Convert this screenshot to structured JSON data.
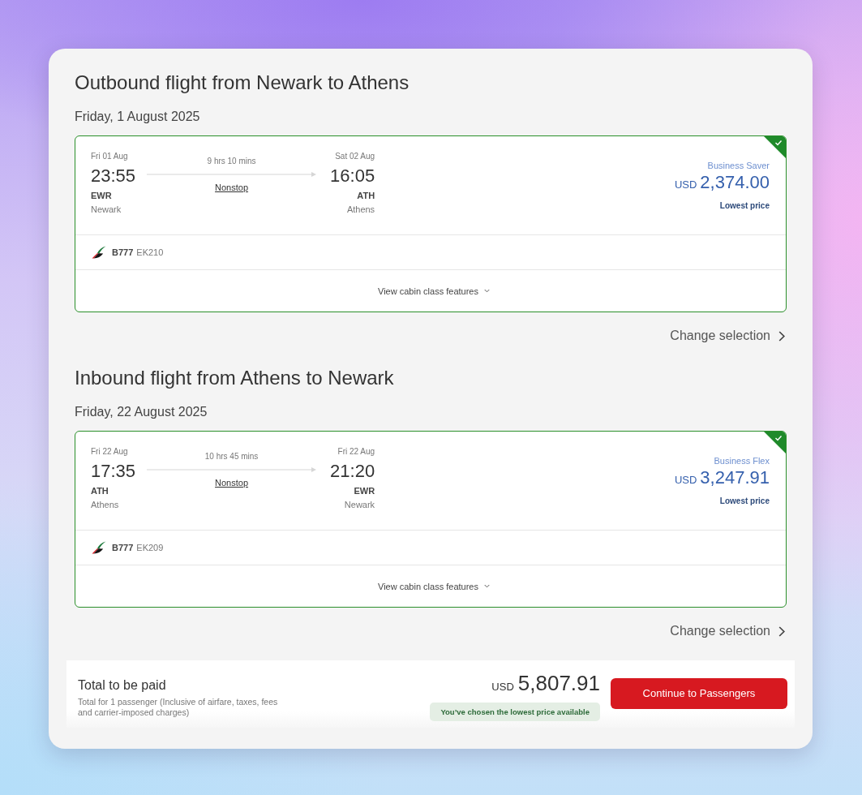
{
  "sections": [
    {
      "title": "Outbound flight from Newark to Athens",
      "date": "Friday, 1 August 2025",
      "flight": {
        "selected": true,
        "departure": {
          "date": "Fri 01 Aug",
          "time": "23:55",
          "code": "EWR",
          "city": "Newark"
        },
        "duration": "9 hrs 10 mins",
        "stops": "Nonstop",
        "arrival": {
          "date": "Sat 02 Aug",
          "time": "16:05",
          "code": "ATH",
          "city": "Athens"
        },
        "fare_name": "Business Saver",
        "currency": "USD",
        "price": "2,374.00",
        "price_note": "Lowest price",
        "aircraft": "B777",
        "flight_number": "EK210",
        "features_link": "View cabin class features"
      },
      "change_link": "Change selection"
    },
    {
      "title": "Inbound flight from Athens to Newark",
      "date": "Friday, 22 August 2025",
      "flight": {
        "selected": true,
        "departure": {
          "date": "Fri 22 Aug",
          "time": "17:35",
          "code": "ATH",
          "city": "Athens"
        },
        "duration": "10 hrs 45 mins",
        "stops": "Nonstop",
        "arrival": {
          "date": "Fri 22 Aug",
          "time": "21:20",
          "code": "EWR",
          "city": "Newark"
        },
        "fare_name": "Business Flex",
        "currency": "USD",
        "price": "3,247.91",
        "price_note": "Lowest price",
        "aircraft": "B777",
        "flight_number": "EK209",
        "features_link": "View cabin class features"
      },
      "change_link": "Change selection"
    }
  ],
  "total": {
    "title": "Total to be paid",
    "note": "Total for 1 passenger (Inclusive of airfare, taxes, fees and carrier-imposed charges)",
    "currency": "USD",
    "amount": "5,807.91",
    "badge": "You’ve chosen the lowest price available",
    "button": "Continue to Passengers"
  }
}
